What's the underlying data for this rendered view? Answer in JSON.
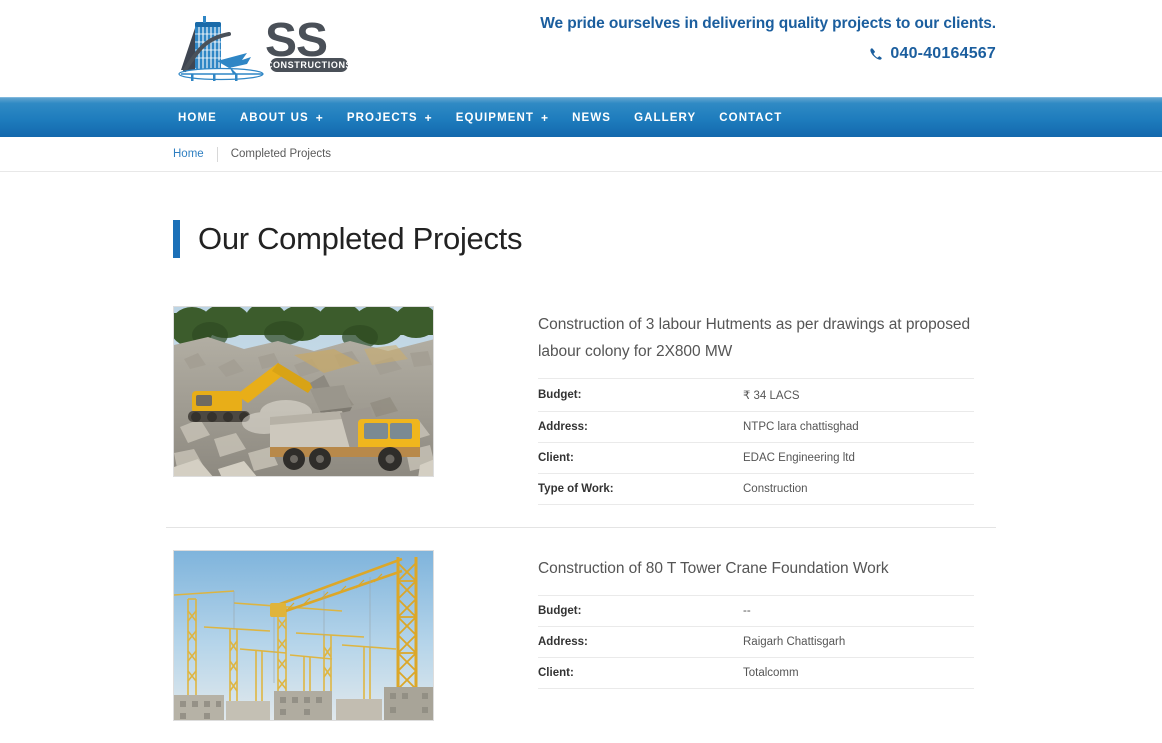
{
  "header": {
    "logo_text": "SS",
    "logo_sub": "CONSTRUCTIONS",
    "tagline": "We pride ourselves in delivering quality projects to our clients.",
    "phone": "040-40164567",
    "phone_icon": "phone-icon",
    "accent_color": "#1b5e9e"
  },
  "nav": {
    "items": [
      {
        "label": "HOME",
        "has_dropdown": false
      },
      {
        "label": "ABOUT US",
        "has_dropdown": true
      },
      {
        "label": "PROJECTS",
        "has_dropdown": true
      },
      {
        "label": "EQUIPMENT",
        "has_dropdown": true
      },
      {
        "label": "NEWS",
        "has_dropdown": false
      },
      {
        "label": "GALLERY",
        "has_dropdown": false
      },
      {
        "label": "CONTACT",
        "has_dropdown": false
      }
    ],
    "plus_glyph": "+",
    "gradient_top": "#5fa3cf",
    "gradient_bottom": "#1368ad"
  },
  "breadcrumb": {
    "home": "Home",
    "current": "Completed Projects"
  },
  "page": {
    "title": "Our Completed Projects",
    "accent_color": "#1b70b8"
  },
  "projects": [
    {
      "title": "Construction of 3 labour Hutments as per drawings at proposed labour colony for 2X800 MW",
      "image_alt": "excavator-loading-dump-truck-quarry",
      "specs": [
        {
          "key": "Budget:",
          "value": "₹ 34 LACS"
        },
        {
          "key": "Address:",
          "value": "NTPC lara chattisghad"
        },
        {
          "key": "Client:",
          "value": "EDAC Engineering ltd"
        },
        {
          "key": "Type of Work:",
          "value": "Construction"
        }
      ]
    },
    {
      "title": "Construction of 80 T Tower Crane Foundation Work",
      "image_alt": "tower-cranes-construction-site-skyline",
      "specs": [
        {
          "key": "Budget:",
          "value": "--"
        },
        {
          "key": "Address:",
          "value": "Raigarh Chattisgarh"
        },
        {
          "key": "Client:",
          "value": "Totalcomm"
        }
      ]
    }
  ]
}
